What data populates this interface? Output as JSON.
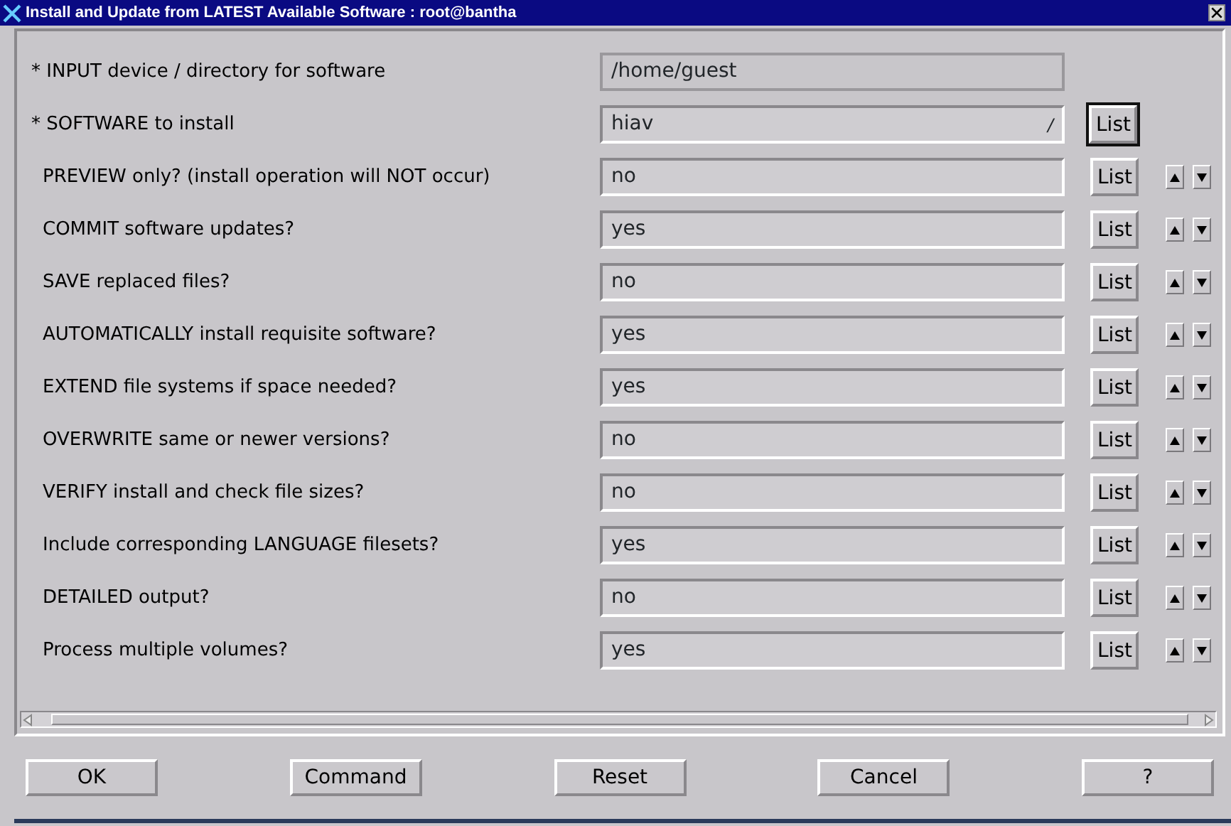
{
  "window": {
    "title": "Install and Update from LATEST Available Software : root@bantha"
  },
  "rows": [
    {
      "label": "* INPUT device / directory for software",
      "value": "/home/guest",
      "kind": "display"
    },
    {
      "label": "* SOFTWARE to install",
      "value": "hiav",
      "marker": "/",
      "kind": "entry",
      "list_button": "List",
      "focused": true
    },
    {
      "label": "PREVIEW only? (install operation will NOT occur)",
      "value": "no",
      "kind": "toggle",
      "list_button": "List",
      "focused": false
    },
    {
      "label": "COMMIT software updates?",
      "value": "yes",
      "kind": "toggle",
      "list_button": "List",
      "focused": false
    },
    {
      "label": "SAVE replaced files?",
      "value": "no",
      "kind": "toggle",
      "list_button": "List",
      "focused": false
    },
    {
      "label": "AUTOMATICALLY install requisite software?",
      "value": "yes",
      "kind": "toggle",
      "list_button": "List",
      "focused": false
    },
    {
      "label": "EXTEND file systems if space needed?",
      "value": "yes",
      "kind": "toggle",
      "list_button": "List",
      "focused": false
    },
    {
      "label": "OVERWRITE same or newer versions?",
      "value": "no",
      "kind": "toggle",
      "list_button": "List",
      "focused": false
    },
    {
      "label": "VERIFY install and check file sizes?",
      "value": "no",
      "kind": "toggle",
      "list_button": "List",
      "focused": false
    },
    {
      "label": "Include corresponding LANGUAGE filesets?",
      "value": "yes",
      "kind": "toggle",
      "list_button": "List",
      "focused": false
    },
    {
      "label": "DETAILED output?",
      "value": "no",
      "kind": "toggle",
      "list_button": "List",
      "focused": false
    },
    {
      "label": "Process multiple volumes?",
      "value": "yes",
      "kind": "toggle",
      "list_button": "List",
      "focused": false
    }
  ],
  "buttons": [
    "OK",
    "Command",
    "Reset",
    "Cancel",
    "?"
  ]
}
